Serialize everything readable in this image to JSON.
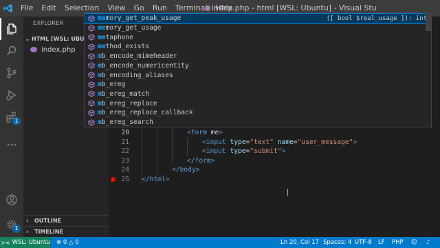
{
  "titlebar": {
    "menu": [
      "File",
      "Edit",
      "Selection",
      "View",
      "Go",
      "Run",
      "Terminal",
      "Help"
    ],
    "window_title": "index.php - html [WSL: Ubuntu] - Visual Studio Co"
  },
  "activity": {
    "explorer_icon": "files-icon",
    "search_icon": "search-icon",
    "scm_icon": "source-control-icon",
    "debug_icon": "run-debug-icon",
    "extensions_icon": "extensions-icon",
    "extensions_badge": "1",
    "more_icon": "ellipsis-icon",
    "account_icon": "account-icon",
    "settings_icon": "gear-icon",
    "settings_badge": "1"
  },
  "sidebar": {
    "title": "EXPLORER",
    "section": "HTML [WSL: UBUNTU]",
    "file": "index.php",
    "outline": "OUTLINE",
    "timeline": "TIMELINE"
  },
  "suggest": {
    "items": [
      {
        "match": "me",
        "rest": "mory_get_peak_usage"
      },
      {
        "match": "me",
        "rest": "mory_get_usage"
      },
      {
        "match": "me",
        "rest": "taphone"
      },
      {
        "match": "me",
        "rest": "thod_exists"
      },
      {
        "match": "m",
        "rest": "b_encode_mimeheader"
      },
      {
        "match": "m",
        "rest": "b_encode_numericentity"
      },
      {
        "match": "m",
        "rest": "b_encoding_aliases"
      },
      {
        "match": "m",
        "rest": "b_ereg"
      },
      {
        "match": "m",
        "rest": "b_ereg_match"
      },
      {
        "match": "m",
        "rest": "b_ereg_replace"
      },
      {
        "match": "m",
        "rest": "b_ereg_replace_callback"
      },
      {
        "match": "m",
        "rest": "b_ereg_search"
      }
    ],
    "detail": "([ bool $real_usage ]): int"
  },
  "editor": {
    "lines": [
      {
        "num": "20",
        "indent": 3,
        "parts": [
          [
            "tag",
            "<form"
          ],
          [
            "text",
            " me"
          ],
          [
            "tag",
            ">"
          ]
        ]
      },
      {
        "num": "21",
        "indent": 4,
        "parts": [
          [
            "tag",
            "<input"
          ],
          [
            "text",
            " "
          ],
          [
            "attr",
            "type"
          ],
          [
            "text",
            "="
          ],
          [
            "str",
            "\"text\""
          ],
          [
            "text",
            " "
          ],
          [
            "attr",
            "name"
          ],
          [
            "text",
            "="
          ],
          [
            "str",
            "\"user_message\""
          ],
          [
            "tag",
            ">"
          ]
        ]
      },
      {
        "num": "22",
        "indent": 4,
        "parts": [
          [
            "tag",
            "<input"
          ],
          [
            "text",
            " "
          ],
          [
            "attr",
            "type"
          ],
          [
            "text",
            "="
          ],
          [
            "str",
            "\"submit\""
          ],
          [
            "tag",
            ">"
          ]
        ]
      },
      {
        "num": "23",
        "indent": 3,
        "parts": [
          [
            "tag",
            "</form>"
          ]
        ]
      },
      {
        "num": "24",
        "indent": 2,
        "parts": [
          [
            "tag",
            "</body>"
          ]
        ]
      },
      {
        "num": "25",
        "indent": 0,
        "parts": [
          [
            "tag",
            "</html>"
          ]
        ]
      }
    ]
  },
  "statusbar": {
    "remote": "WSL: Ubuntu",
    "errors": "0",
    "warnings": "0",
    "position": "Ln 20, Col 17",
    "spaces": "Spaces: 4",
    "encoding": "UTF-8",
    "eol": "LF",
    "language": "PHP"
  },
  "colors": {
    "accent": "#007acc",
    "remote": "#16825d",
    "match_highlight": "#18a3ff",
    "breakpoint": "#e51400"
  }
}
